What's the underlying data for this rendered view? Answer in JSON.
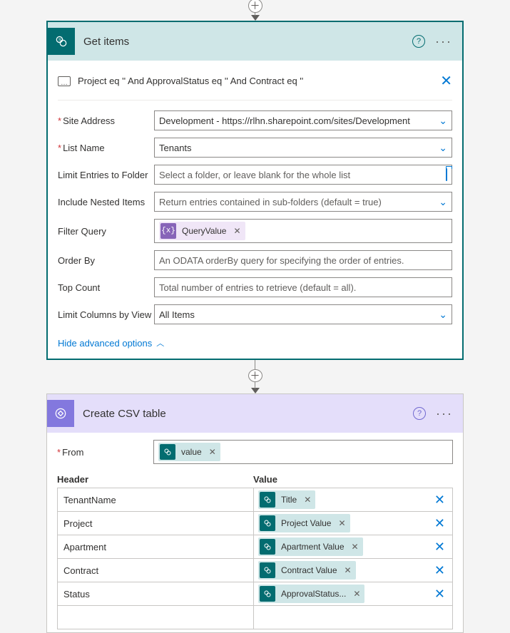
{
  "getitems": {
    "title": "Get items",
    "peek_text": "Project eq '' And ApprovalStatus eq '' And Contract eq ''",
    "labels": {
      "site_address": "Site Address",
      "list_name": "List Name",
      "limit_folder": "Limit Entries to Folder",
      "include_nested": "Include Nested Items",
      "filter_query": "Filter Query",
      "order_by": "Order By",
      "top_count": "Top Count",
      "limit_view": "Limit Columns by View"
    },
    "values": {
      "site_address": "Development - https://rlhn.sharepoint.com/sites/Development",
      "list_name": "Tenants",
      "limit_folder_placeholder": "Select a folder, or leave blank for the whole list",
      "include_nested": "Return entries contained in sub-folders (default = true)",
      "filter_token": "QueryValue",
      "order_by_placeholder": "An ODATA orderBy query for specifying the order of entries.",
      "top_count_placeholder": "Total number of entries to retrieve (default = all).",
      "limit_view": "All Items"
    },
    "advanced_link": "Hide advanced options"
  },
  "csv": {
    "title": "Create CSV table",
    "from_label": "From",
    "from_token": "value",
    "header_col": "Header",
    "value_col": "Value",
    "rows": [
      {
        "header": "TenantName",
        "value_token": "Title"
      },
      {
        "header": "Project",
        "value_token": "Project Value"
      },
      {
        "header": "Apartment",
        "value_token": "Apartment Value"
      },
      {
        "header": "Contract",
        "value_token": "Contract Value"
      },
      {
        "header": "Status",
        "value_token": "ApprovalStatus..."
      }
    ]
  }
}
